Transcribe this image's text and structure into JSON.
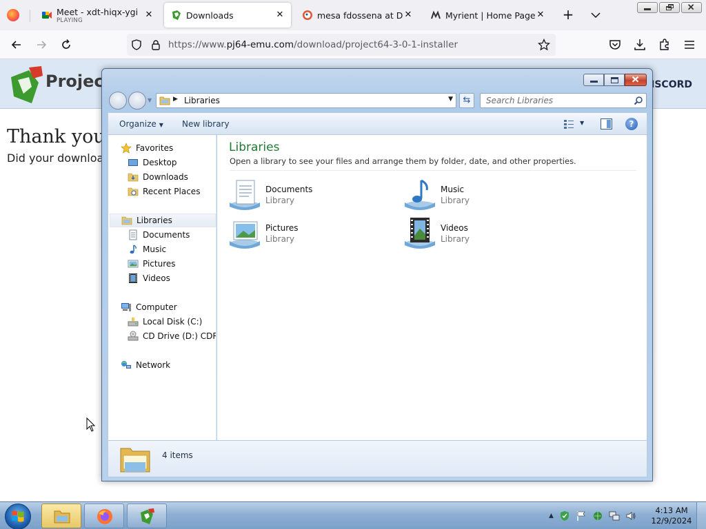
{
  "browser": {
    "tabs": [
      {
        "title": "Meet - xdt-hiqx-ygi",
        "subtitle": "PLAYING",
        "active": false
      },
      {
        "title": "Downloads",
        "active": true
      },
      {
        "title": "mesa fdossena at DuckD",
        "active": false
      },
      {
        "title": "Myrient | Home Page",
        "active": false
      }
    ],
    "url_base": "https://www.",
    "url_host": "pj64-emu.com",
    "url_path": "/download/project64-3-0-1-installer"
  },
  "page": {
    "logo_text": "Projec",
    "discord": "DISCORD",
    "heading": "Thank you",
    "subtext": "Did your downloa"
  },
  "explorer": {
    "address": "Libraries",
    "search_placeholder": "Search Libraries",
    "toolbar": {
      "organize": "Organize",
      "new_library": "New library"
    },
    "nav": {
      "favorites": "Favorites",
      "desktop": "Desktop",
      "downloads": "Downloads",
      "recent": "Recent Places",
      "libraries": "Libraries",
      "documents": "Documents",
      "music": "Music",
      "pictures": "Pictures",
      "videos": "Videos",
      "computer": "Computer",
      "local_disk": "Local Disk (C:)",
      "cd_drive": "CD Drive (D:) CDROM",
      "network": "Network"
    },
    "title": "Libraries",
    "description": "Open a library to see your files and arrange them by folder, date, and other properties.",
    "libraries": [
      {
        "name": "Documents",
        "type": "Library",
        "icon": "documents-library-icon"
      },
      {
        "name": "Music",
        "type": "Library",
        "icon": "music-library-icon"
      },
      {
        "name": "Pictures",
        "type": "Library",
        "icon": "pictures-library-icon"
      },
      {
        "name": "Videos",
        "type": "Library",
        "icon": "videos-library-icon"
      }
    ],
    "status": "4 items"
  },
  "taskbar": {
    "time": "4:13 AM",
    "date": "12/9/2024"
  },
  "colors": {
    "library_title": "#1e7b31",
    "taskbar": "#8fb0d4",
    "firefox_tabstrip": "#f0f0f4"
  }
}
